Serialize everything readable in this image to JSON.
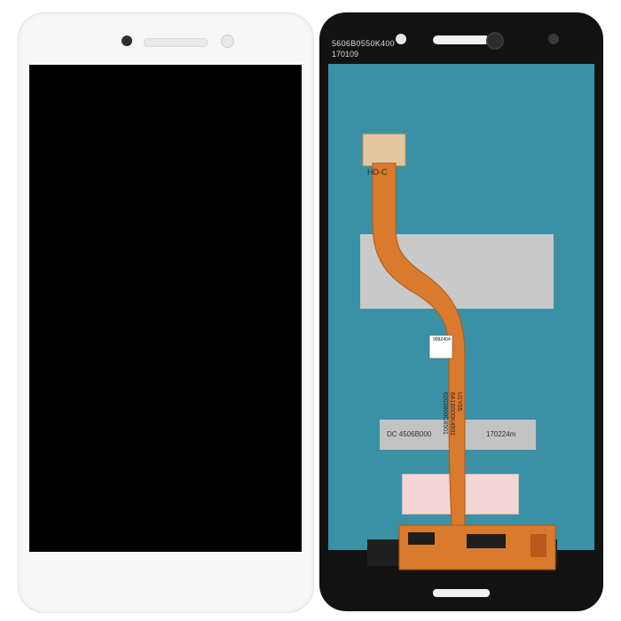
{
  "back_panel": {
    "serial_code": "5606B0550K400",
    "date_code": "170109",
    "flex_label": "HD-C",
    "qr_code": "908Z404",
    "flex_code_1": "6203800C8501",
    "flex_code_2": "6A1B500K4501",
    "flex_code_3": "U1Y05",
    "label_dc": "DC 4506B000",
    "label_date": "170224m"
  },
  "colors": {
    "front_bezel": "#f7f7f7",
    "screen": "#000000",
    "lcd_back": "#3a91a6",
    "flex_cable": "#d97a2c",
    "frame": "#121212"
  }
}
